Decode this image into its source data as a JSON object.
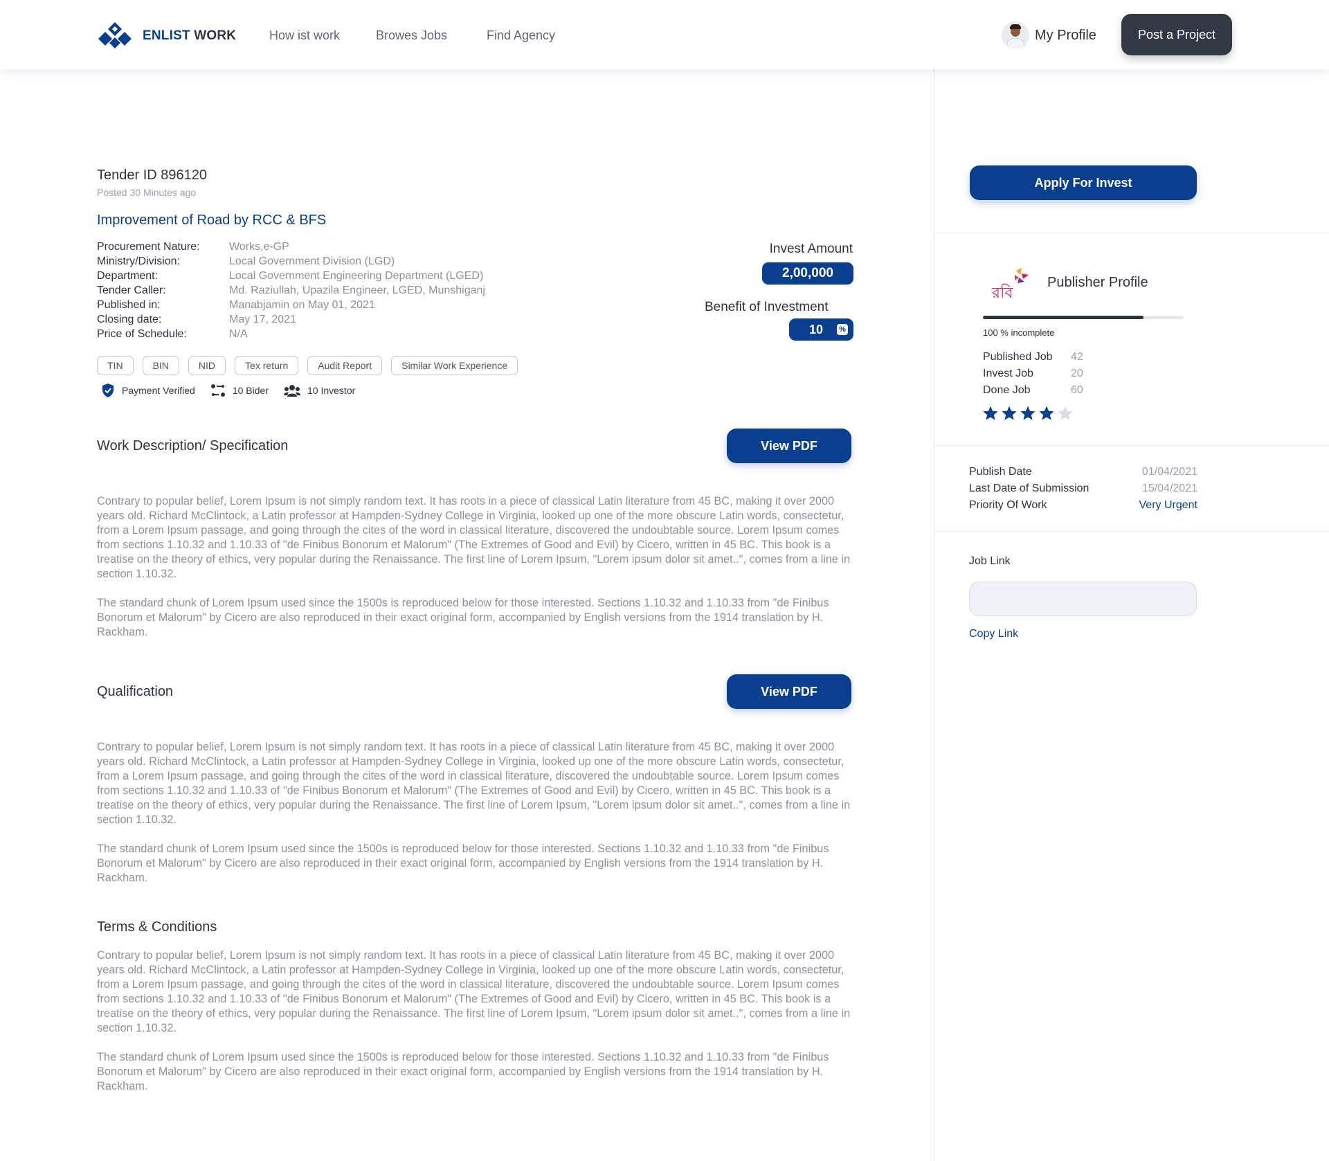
{
  "brand": {
    "name_part1": "ENLIST",
    "name_part2": "WORK",
    "logo": "enlist-work-logo",
    "primary_color": "#0a3f8f",
    "dark_color": "#323844"
  },
  "nav": {
    "items": [
      "How ist work",
      "Browes Jobs",
      "Find Agency"
    ]
  },
  "header": {
    "profile_label": "My Profile",
    "post_button": "Post a Project"
  },
  "tender": {
    "id_text": "Tender ID 896120",
    "posted": "Posted 30 Minutes ago",
    "title": "Improvement of Road by RCC & BFS",
    "details": [
      {
        "label": "Procurement Nature:",
        "value": "Works,e-GP"
      },
      {
        "label": "Ministry/Division:",
        "value": "Local Government Division (LGD)"
      },
      {
        "label": "Department:",
        "value": "Local Government Engineering Department (LGED)"
      },
      {
        "label": "Tender Caller:",
        "value": "Md. Raziullah, Upazila Engineer, LGED, Munshiganj"
      },
      {
        "label": "Published in:",
        "value": "Manabjamin on May 01, 2021"
      },
      {
        "label": "Closing date:",
        "value": "May 17, 2021"
      },
      {
        "label": "Price of Schedule:",
        "value": "N/A"
      }
    ],
    "invest_label": "Invest Amount",
    "invest_amount": "2,00,000",
    "benefit_label": "Benefit of Investment",
    "benefit_value": "10",
    "benefit_unit": "%",
    "tags": [
      "TIN",
      "BIN",
      "NID",
      "Tex return",
      "Audit Report",
      "Similar Work Experience"
    ],
    "stats": [
      {
        "icon": "shield-check-icon",
        "text": "Payment Verified"
      },
      {
        "icon": "bidder-icon",
        "text": "10 Bider"
      },
      {
        "icon": "investors-icon",
        "text": "10 Investor"
      }
    ]
  },
  "sections": {
    "work": {
      "title": "Work Description/ Specification",
      "button": "View PDF",
      "p1": "Contrary to popular belief, Lorem Ipsum is not simply random text. It has roots in a piece of classical Latin literature from 45 BC, making it over 2000 years old. Richard McClintock, a Latin professor at Hampden-Sydney College in Virginia, looked up one of the more obscure Latin words, consectetur, from a Lorem Ipsum passage, and going through the cites of the word in classical literature, discovered the undoubtable source. Lorem Ipsum comes from sections 1.10.32 and 1.10.33 of \"de Finibus Bonorum et Malorum\" (The Extremes of Good and Evil) by Cicero, written in 45 BC. This book is a treatise on the theory of ethics, very popular during the Renaissance. The first line of Lorem Ipsum, \"Lorem ipsum dolor sit amet..\", comes from a line in section 1.10.32.",
      "p2": "The standard chunk of Lorem Ipsum used since the 1500s is reproduced below for those interested. Sections 1.10.32 and 1.10.33 from \"de Finibus Bonorum et Malorum\" by Cicero are also reproduced in their exact original form, accompanied by English versions from the 1914 translation by H. Rackham."
    },
    "qualification": {
      "title": "Qualification",
      "button": "View PDF",
      "p1": "Contrary to popular belief, Lorem Ipsum is not simply random text. It has roots in a piece of classical Latin literature from 45 BC, making it over 2000 years old. Richard McClintock, a Latin professor at Hampden-Sydney College in Virginia, looked up one of the more obscure Latin words, consectetur, from a Lorem Ipsum passage, and going through the cites of the word in classical literature, discovered the undoubtable source. Lorem Ipsum comes from sections 1.10.32 and 1.10.33 of \"de Finibus Bonorum et Malorum\" (The Extremes of Good and Evil) by Cicero, written in 45 BC. This book is a treatise on the theory of ethics, very popular during the Renaissance. The first line of Lorem Ipsum, \"Lorem ipsum dolor sit amet..\", comes from a line in section 1.10.32.",
      "p2": "The standard chunk of Lorem Ipsum used since the 1500s is reproduced below for those interested. Sections 1.10.32 and 1.10.33 from \"de Finibus Bonorum et Malorum\" by Cicero are also reproduced in their exact original form, accompanied by English versions from the 1914 translation by H. Rackham."
    },
    "terms": {
      "title": "Terms & Conditions",
      "p1": "Contrary to popular belief, Lorem Ipsum is not simply random text. It has roots in a piece of classical Latin literature from 45 BC, making it over 2000 years old. Richard McClintock, a Latin professor at Hampden-Sydney College in Virginia, looked up one of the more obscure Latin words, consectetur, from a Lorem Ipsum passage, and going through the cites of the word in classical literature, discovered the undoubtable source. Lorem Ipsum comes from sections 1.10.32 and 1.10.33 of \"de Finibus Bonorum et Malorum\" (The Extremes of Good and Evil) by Cicero, written in 45 BC. This book is a treatise on the theory of ethics, very popular during the Renaissance. The first line of Lorem Ipsum, \"Lorem ipsum dolor sit amet..\", comes from a line in section 1.10.32.",
      "p2": "The standard chunk of Lorem Ipsum used since the 1500s is reproduced below for those interested. Sections 1.10.32 and 1.10.33 from \"de Finibus Bonorum et Malorum\" by Cicero are also reproduced in their exact original form, accompanied by English versions from the 1914 translation by H. Rackham."
    }
  },
  "sidebar": {
    "apply_button": "Apply For Invest",
    "publisher_logo": "robi-logo",
    "publisher_logo_text": "রবি",
    "publisher_title": "Publisher Profile",
    "profile_progress": 0.8,
    "incomplete_text": "100 % incomplete",
    "stats": [
      {
        "label": "Published Job",
        "value": "42"
      },
      {
        "label": "Invest Job",
        "value": "20"
      },
      {
        "label": "Done Job",
        "value": "60"
      }
    ],
    "rating": 4,
    "rating_max": 5,
    "star_color": "#0a3f8f",
    "dates": [
      {
        "label": "Publish Date",
        "value": "01/04/2021"
      },
      {
        "label": "Last Date of Submission",
        "value": "15/04/2021"
      },
      {
        "label": "Priority Of Work",
        "value": "Very Urgent"
      }
    ],
    "job_link_label": "Job Link",
    "job_link_value": "",
    "copy_link": "Copy Link"
  }
}
